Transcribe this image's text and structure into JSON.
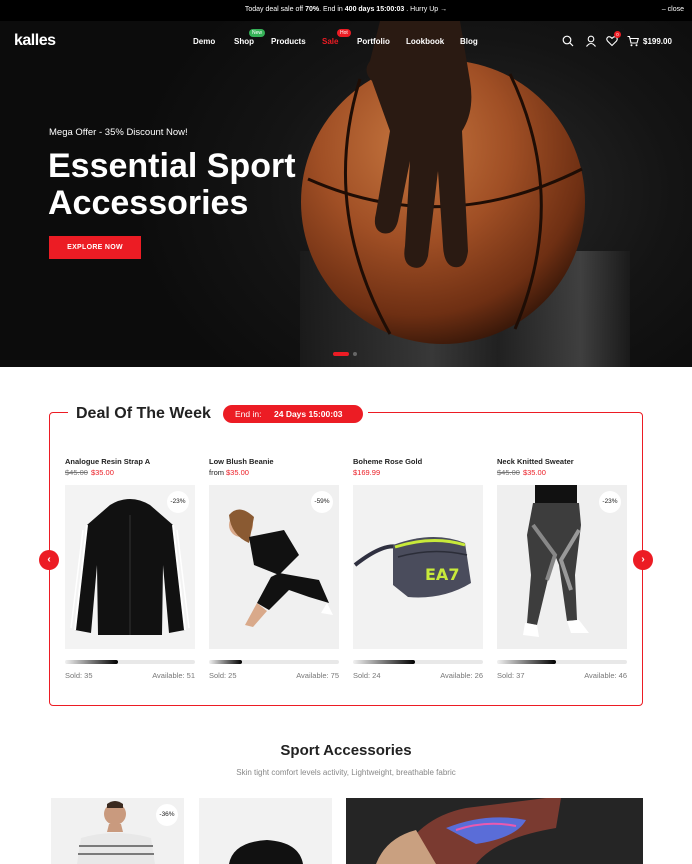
{
  "announcement": {
    "prefix": "Today deal sale off",
    "percent": "70%",
    "middle": ". End in",
    "countdown": "400 days 15:00:03",
    "suffix": ". Hurry Up →",
    "close": "– close"
  },
  "header": {
    "logo": "kalles",
    "nav": [
      {
        "label": "Demo",
        "badge": ""
      },
      {
        "label": "Shop",
        "badge": "New",
        "badge_color": "#35b157"
      },
      {
        "label": "Products",
        "badge": ""
      },
      {
        "label": "Sale",
        "badge": "Hot",
        "badge_color": "#ec1c24"
      },
      {
        "label": "Portfolio",
        "badge": ""
      },
      {
        "label": "Lookbook",
        "badge": ""
      },
      {
        "label": "Blog",
        "badge": ""
      }
    ],
    "icons": [
      "search-icon",
      "user-icon",
      "heart-icon",
      "cart-icon"
    ],
    "wishlist_count": "0",
    "cart_total": "$199.00"
  },
  "hero": {
    "kicker": "Mega Offer - 35% Discount Now!",
    "title_line1": "Essential Sport",
    "title_line2": "Accessories",
    "cta": "EXPLORE NOW",
    "active_slide": 1,
    "slide_count": 2
  },
  "deal": {
    "title": "Deal Of The Week",
    "timer_label": "End in:",
    "timer_value": "24 Days 15:00:03",
    "products": [
      {
        "name": "Analogue Resin Strap A",
        "old_price": "$45.00",
        "price": "$35.00",
        "from": "",
        "discount": "-23%",
        "sold_label": "Sold: 35",
        "available_label": "Available: 51",
        "sold_fraction": 0.41
      },
      {
        "name": "Low Blush Beanie",
        "old_price": "",
        "price": "$35.00",
        "from": "from",
        "discount": "-59%",
        "sold_label": "Sold: 25",
        "available_label": "Available: 75",
        "sold_fraction": 0.25
      },
      {
        "name": "Boheme Rose Gold",
        "old_price": "",
        "price": "$169.99",
        "from": "",
        "discount": "",
        "sold_label": "Sold: 24",
        "available_label": "Available: 26",
        "sold_fraction": 0.48
      },
      {
        "name": "Neck Knitted Sweater",
        "old_price": "$45.00",
        "price": "$35.00",
        "from": "",
        "discount": "-23%",
        "sold_label": "Sold: 37",
        "available_label": "Available: 46",
        "sold_fraction": 0.45
      }
    ]
  },
  "sport": {
    "title": "Sport Accessories",
    "subtitle": "Skin tight comfort levels activity, Lightweight, breathable fabric",
    "first_discount": "-36%"
  },
  "colors": {
    "accent": "#ec1c24",
    "dark": "#000000"
  }
}
